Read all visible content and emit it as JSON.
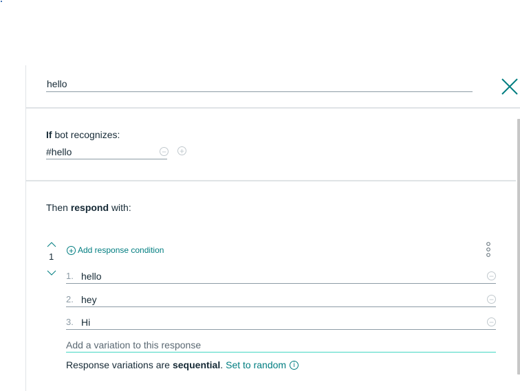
{
  "node": {
    "name": "hello"
  },
  "condition": {
    "label_bold": "If",
    "label_rest": "bot recognizes:",
    "value": "#hello"
  },
  "response": {
    "label_prefix": "Then",
    "label_bold": "respond",
    "label_suffix": "with:",
    "index": "1",
    "add_condition_label": "Add response condition",
    "variations": [
      {
        "num": "1.",
        "text": "hello"
      },
      {
        "num": "2.",
        "text": "hey"
      },
      {
        "num": "3.",
        "text": "Hi"
      }
    ],
    "add_variation_placeholder": "Add a variation to this response",
    "mode_prefix": "Response variations are",
    "mode_value": "sequential",
    "mode_period": ".",
    "mode_link": "Set to random"
  },
  "colors": {
    "accent": "#007d80",
    "focus_underline": "#41d6c3",
    "border": "#dfe3e6",
    "text": "#152935"
  },
  "icons": {
    "close": "close-icon",
    "remove": "minus-circle-icon",
    "add": "plus-circle-icon",
    "up": "chevron-up-icon",
    "down": "chevron-down-icon",
    "more": "overflow-menu-icon",
    "info": "info-icon"
  }
}
